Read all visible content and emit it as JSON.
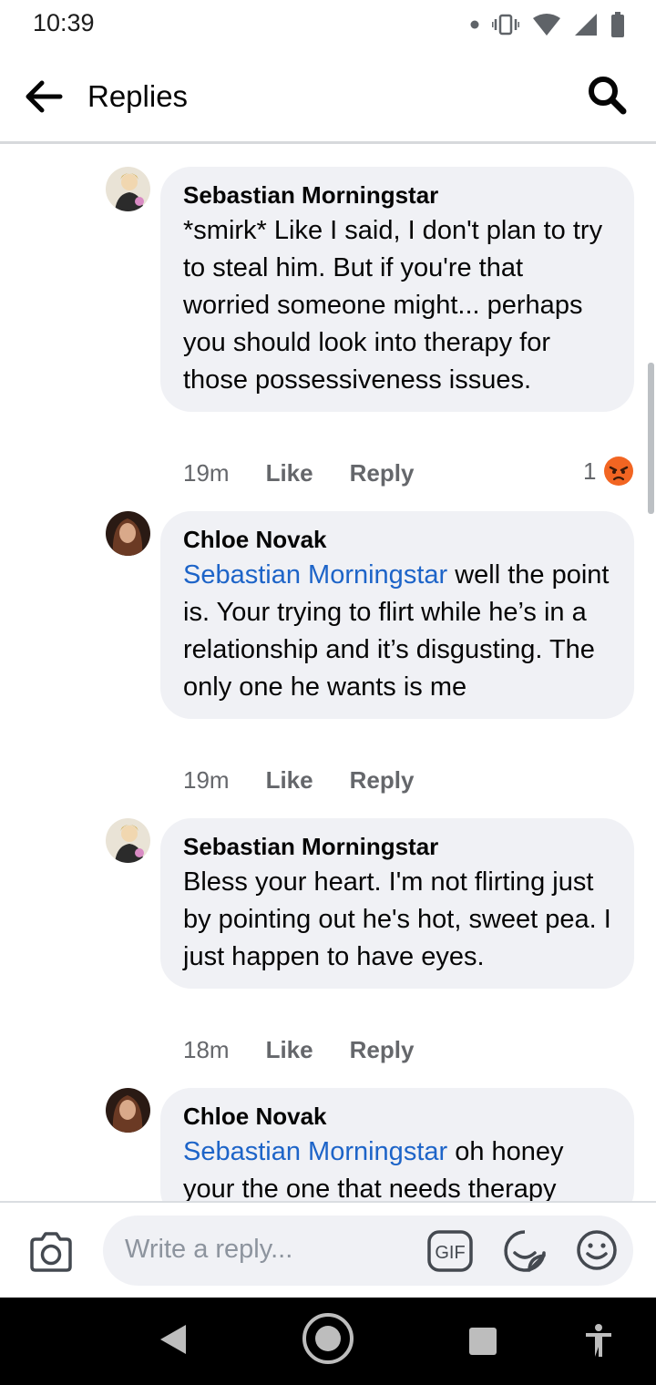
{
  "status_bar": {
    "time": "10:39"
  },
  "header": {
    "title": "Replies"
  },
  "comments": [
    {
      "author": "Sebastian Morningstar",
      "mention": "",
      "text": "*smirk* Like I said, I don't plan to try to steal him. But if you're that worried someone might... perhaps you should look into therapy for those possessiveness issues.",
      "time": "19m",
      "like_label": "Like",
      "reply_label": "Reply",
      "reaction_count": "1",
      "reaction_icon": "angry-reaction-icon"
    },
    {
      "author": "Chloe Novak",
      "mention": "Sebastian Morningstar",
      "text": " well the point is. Your trying to flirt while he’s in a relationship and it’s disgusting. The only one he wants is me",
      "time": "19m",
      "like_label": "Like",
      "reply_label": "Reply"
    },
    {
      "author": "Sebastian Morningstar",
      "mention": "",
      "text": "Bless your heart. I'm not flirting just by pointing out he's hot, sweet pea. I just happen to have eyes.",
      "time": "18m",
      "like_label": "Like",
      "reply_label": "Reply"
    },
    {
      "author": "Chloe Novak",
      "mention": "Sebastian Morningstar",
      "text": " oh honey your the one that needs therapy"
    }
  ],
  "composer": {
    "placeholder": "Write a reply..."
  },
  "colors": {
    "mention": "#1d64c8",
    "bubble": "#f0f1f5",
    "muted": "#65676b",
    "reaction": "#f26522"
  }
}
